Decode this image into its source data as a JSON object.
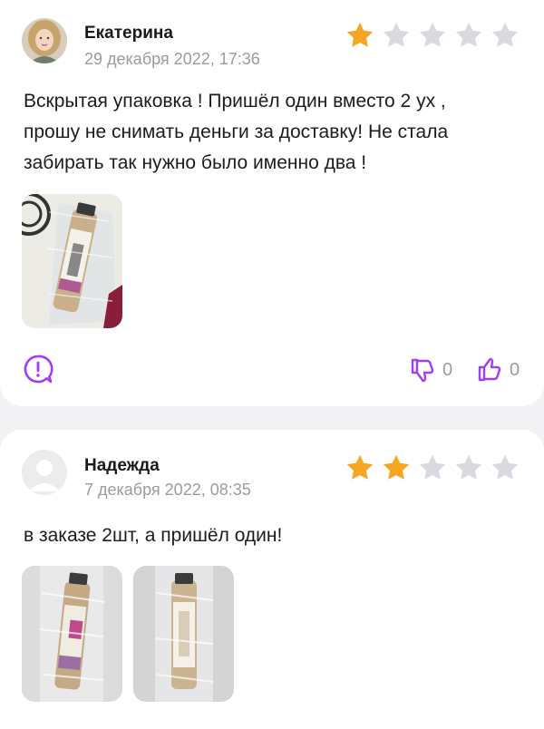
{
  "reviews": [
    {
      "author": "Екатерина",
      "date": "29 декабря 2022, 17:36",
      "rating": 1,
      "text_lines": [
        "Вскрытая упаковка ! Пришёл один вместо 2 ух ,",
        "прошу не снимать деньги за доставку! Не стала",
        "забирать так нужно было именно два !"
      ],
      "dislikes": "0",
      "likes": "0"
    },
    {
      "author": "Надежда",
      "date": "7 декабря 2022, 08:35",
      "rating": 2,
      "text_lines": [
        "в заказе 2шт, а пришёл один!"
      ]
    }
  ],
  "icons": {
    "report": "exclamation-speech-icon",
    "dislike": "thumbs-down-icon",
    "like": "thumbs-up-icon",
    "star": "star-icon"
  },
  "colors": {
    "star_filled": "#f5a623",
    "star_empty": "#d9dae0",
    "accent": "#a23df2",
    "muted": "#9a9ba3"
  }
}
